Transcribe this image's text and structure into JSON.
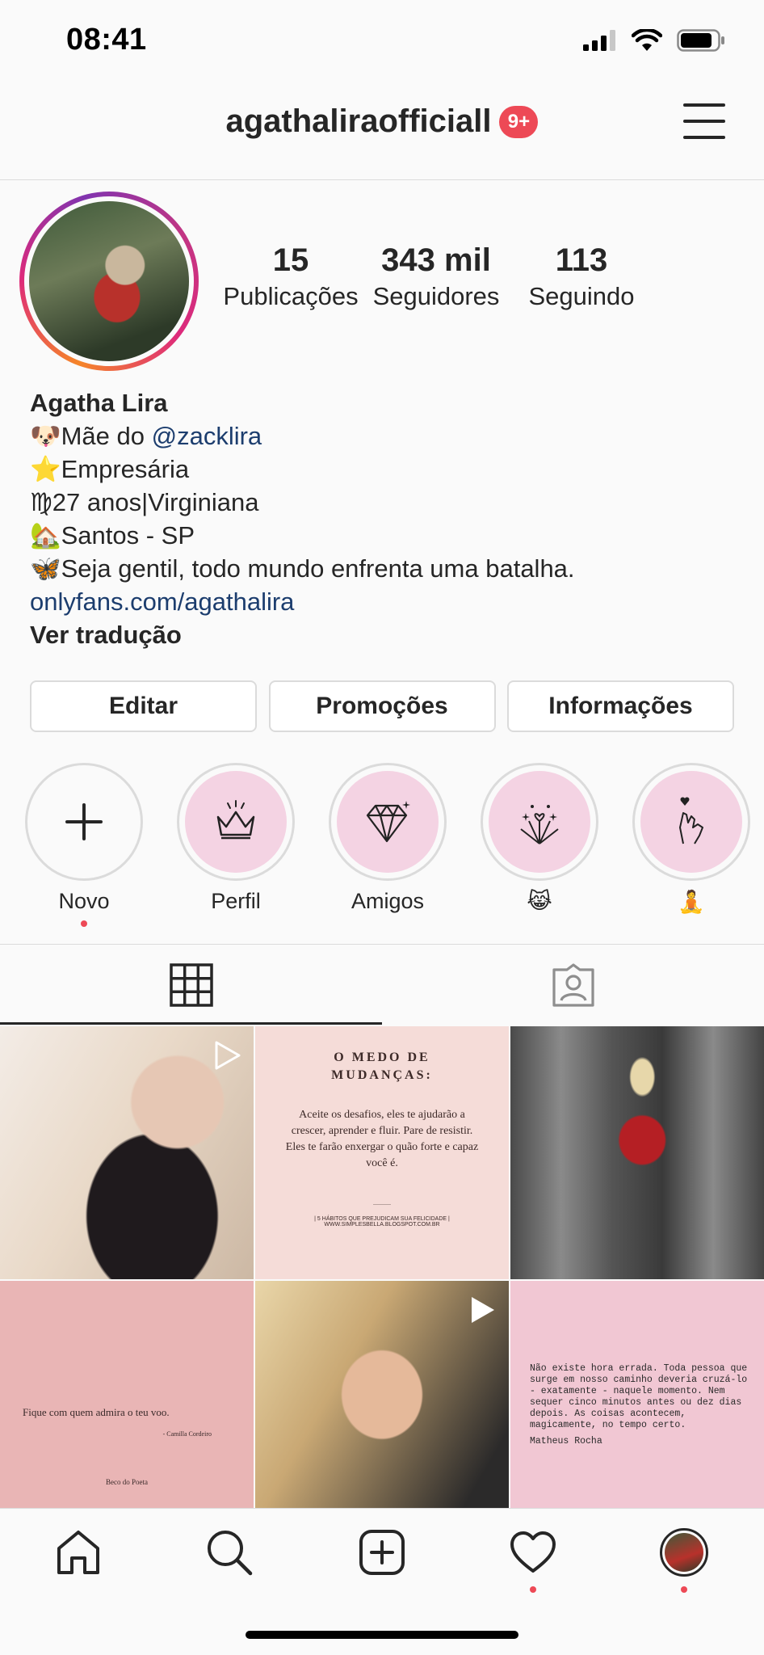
{
  "status_bar": {
    "time": "08:41"
  },
  "header": {
    "username": "agathaliraofficiall",
    "notification_badge": "9+"
  },
  "profile": {
    "stats": [
      {
        "value": "15",
        "label": "Publicações"
      },
      {
        "value": "343 mil",
        "label": "Seguidores"
      },
      {
        "value": "113",
        "label": "Seguindo"
      }
    ],
    "name": "Agatha Lira",
    "bio": {
      "line1_emoji": "🐶",
      "line1_text": "Mãe do ",
      "line1_mention": "@zacklira",
      "line2": "⭐Empresária",
      "line3": "♍27 anos|Virginiana",
      "line4": "🏡Santos - SP",
      "line5": "🦋Seja gentil, todo mundo enfrenta uma batalha."
    },
    "link": "onlyfans.com/agathalira",
    "translate": "Ver tradução"
  },
  "buttons": {
    "edit": "Editar",
    "promotions": "Promoções",
    "info": "Informações"
  },
  "highlights": [
    {
      "label": "Novo",
      "icon": "plus-icon"
    },
    {
      "label": "Perfil",
      "icon": "crown-icon"
    },
    {
      "label": "Amigos",
      "icon": "diamond-icon"
    },
    {
      "label": "😹",
      "icon": "fireworks-icon"
    },
    {
      "label": "🧘",
      "icon": "finger-heart-icon"
    }
  ],
  "tabs": [
    {
      "icon": "grid-icon",
      "active": true
    },
    {
      "icon": "tagged-icon",
      "active": false
    }
  ],
  "posts": {
    "post2": {
      "title_line1": "O MEDO DE",
      "title_line2": "MUDANÇAS:",
      "body": "Aceite os desafios, eles te ajudarão a crescer, aprender e fluir. Pare de resistir. Eles te farão enxergar o quão forte e capaz você é.",
      "footer_line1": "| 5 HÁBITOS QUE PREJUDICAM SUA FELICIDADE |",
      "footer_line2": "WWW.SIMPLESBELLA.BLOGSPOT.COM.BR"
    },
    "post4": {
      "quote": "Fique com quem admira o teu voo.",
      "author": "- Camilla Cordeiro",
      "source": "Beco do Poeta"
    },
    "post6": {
      "quote": "Não existe hora errada. Toda pessoa que surge em nosso caminho deveria cruzá-lo - exatamente - naquele momento. Nem sequer cinco minutos antes ou dez dias depois. As coisas acontecem, magicamente, no tempo certo.",
      "author": "Matheus Rocha"
    }
  },
  "colors": {
    "accent_red": "#ed4956",
    "link_blue": "#1c3d6e",
    "highlight_pink": "#f4d3e3"
  },
  "bottom_nav": [
    "home-icon",
    "search-icon",
    "add-post-icon",
    "heart-icon",
    "profile-avatar"
  ]
}
